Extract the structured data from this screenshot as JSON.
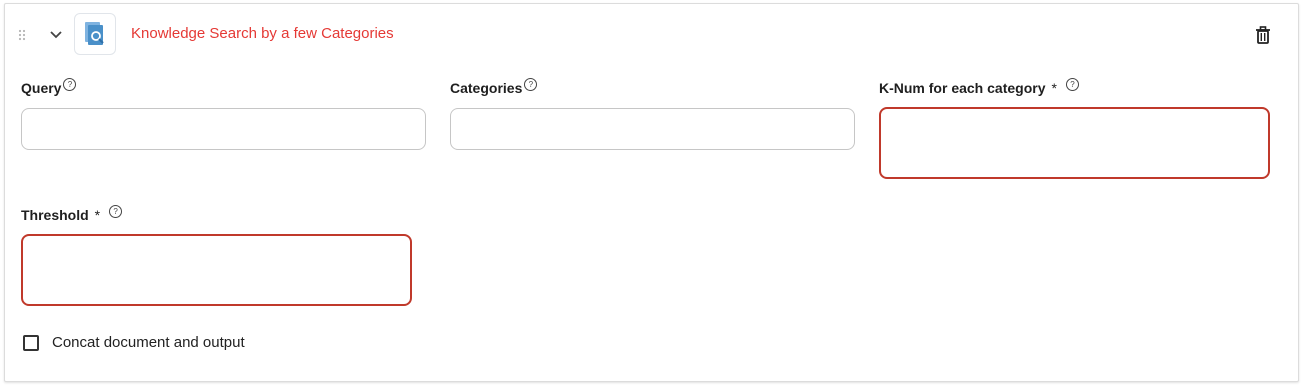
{
  "header": {
    "title": "Knowledge Search by a few Categories",
    "icons": [
      "drag-handle-icon",
      "chevron-down-icon",
      "knowledge-search-icon",
      "trash-icon"
    ]
  },
  "fields": {
    "query": {
      "label": "Query",
      "help": "?"
    },
    "categories": {
      "label": "Categories",
      "help": "?"
    },
    "knum": {
      "label": "K-Num for each category",
      "required": "*",
      "help": "?"
    },
    "threshold": {
      "label": "Threshold",
      "required": "*",
      "help": "?"
    }
  },
  "checkbox": {
    "label": "Concat document and output"
  },
  "colors": {
    "title": "#e53935",
    "error_border": "#c0392b"
  }
}
